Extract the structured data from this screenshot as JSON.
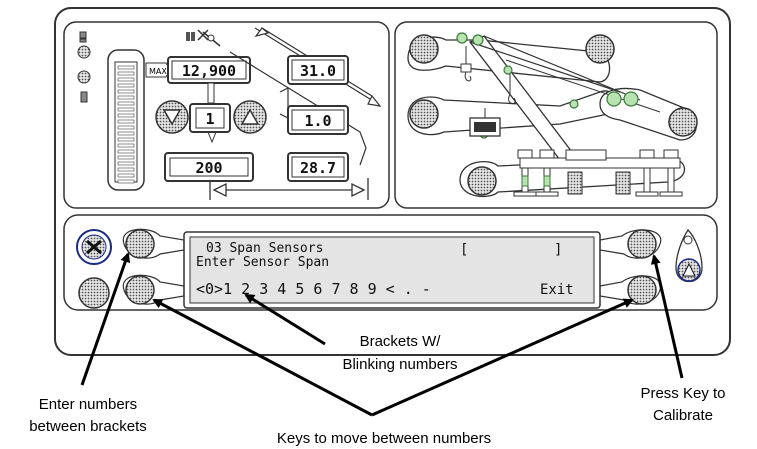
{
  "gauges": {
    "max_label": "MAX",
    "load": "12,900",
    "reeve": "1",
    "radius_or_weight": "200",
    "angle": "31.0",
    "ratio": "1.0",
    "length": "28.7"
  },
  "lcd": {
    "line1_title": "03 Span Sensors",
    "line1_bracket_open": "[",
    "line1_bracket_close": "]",
    "line2": "Enter Sensor Span",
    "line3_prefix": "<0>1 2 3 4 5 6 7 8 9 < . -",
    "line3_exit": "Exit"
  },
  "annotations": {
    "brackets_line1": "Brackets W/",
    "brackets_line2": "Blinking numbers",
    "enter_line1": "Enter numbers",
    "enter_line2": "between brackets",
    "keys_move": "Keys to move between numbers",
    "press_line1": "Press Key to",
    "press_line2": "Calibrate"
  },
  "icons": [
    "bypass-key-icon",
    "calibrate-key-icon",
    "load-hook-icon",
    "crane-icon",
    "up-arrow-icon",
    "down-arrow-icon"
  ]
}
